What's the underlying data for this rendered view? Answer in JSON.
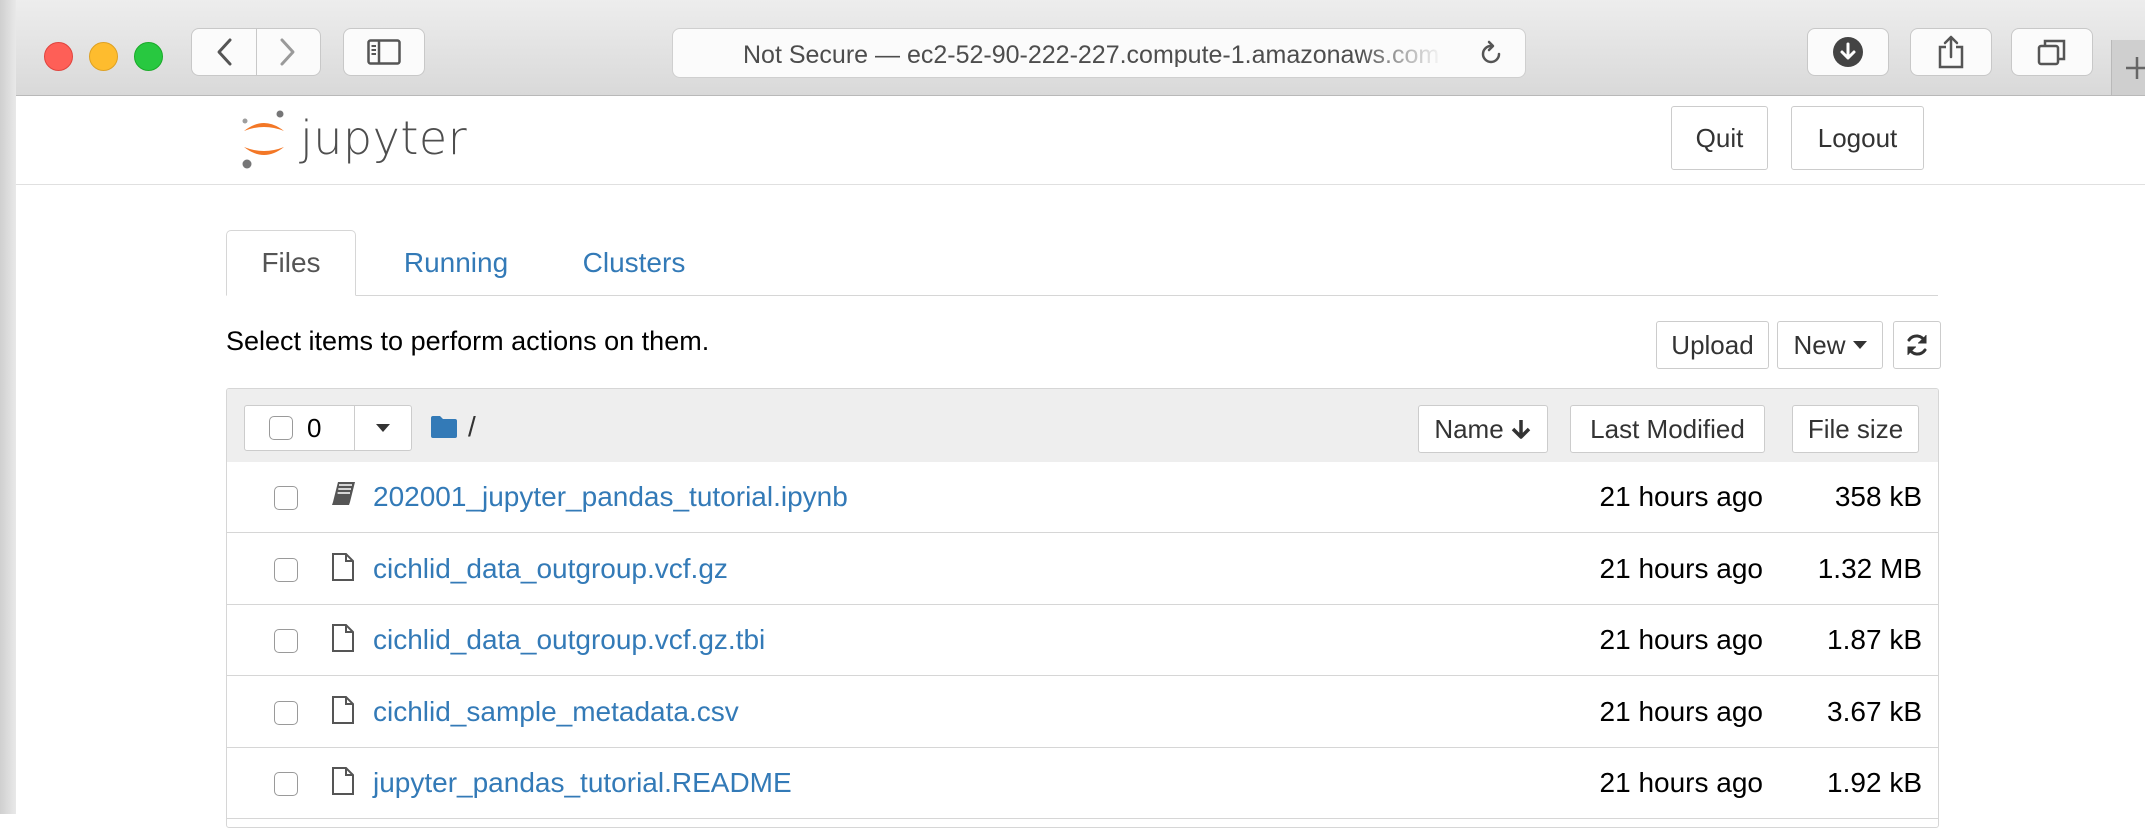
{
  "browser": {
    "address": "Not Secure — ec2-52-90-222-227.compute-1.amazonaws.com"
  },
  "header": {
    "logo_text": "jupyter",
    "quit_label": "Quit",
    "logout_label": "Logout"
  },
  "tabs": [
    {
      "label": "Files",
      "active": true
    },
    {
      "label": "Running",
      "active": false
    },
    {
      "label": "Clusters",
      "active": false
    }
  ],
  "toolbar": {
    "instructions": "Select items to perform actions on them.",
    "upload_label": "Upload",
    "new_label": "New"
  },
  "list_header": {
    "selected_count": "0",
    "path": "/",
    "sort_name_label": "Name",
    "sort_modified_label": "Last Modified",
    "sort_size_label": "File size"
  },
  "files": [
    {
      "name": "202001_jupyter_pandas_tutorial.ipynb",
      "type": "notebook",
      "icon": "notebook-icon",
      "modified": "21 hours ago",
      "size": "358 kB"
    },
    {
      "name": "cichlid_data_outgroup.vcf.gz",
      "type": "file",
      "icon": "file-icon",
      "modified": "21 hours ago",
      "size": "1.32 MB"
    },
    {
      "name": "cichlid_data_outgroup.vcf.gz.tbi",
      "type": "file",
      "icon": "file-icon",
      "modified": "21 hours ago",
      "size": "1.87 kB"
    },
    {
      "name": "cichlid_sample_metadata.csv",
      "type": "file",
      "icon": "file-icon",
      "modified": "21 hours ago",
      "size": "3.67 kB"
    },
    {
      "name": "jupyter_pandas_tutorial.README",
      "type": "file",
      "icon": "file-icon",
      "modified": "21 hours ago",
      "size": "1.92 kB"
    }
  ],
  "colors": {
    "link": "#337ab7",
    "jupyter_orange": "#f37726",
    "close": "#fe5f57",
    "minimize": "#febc2e",
    "zoom": "#28c840"
  }
}
